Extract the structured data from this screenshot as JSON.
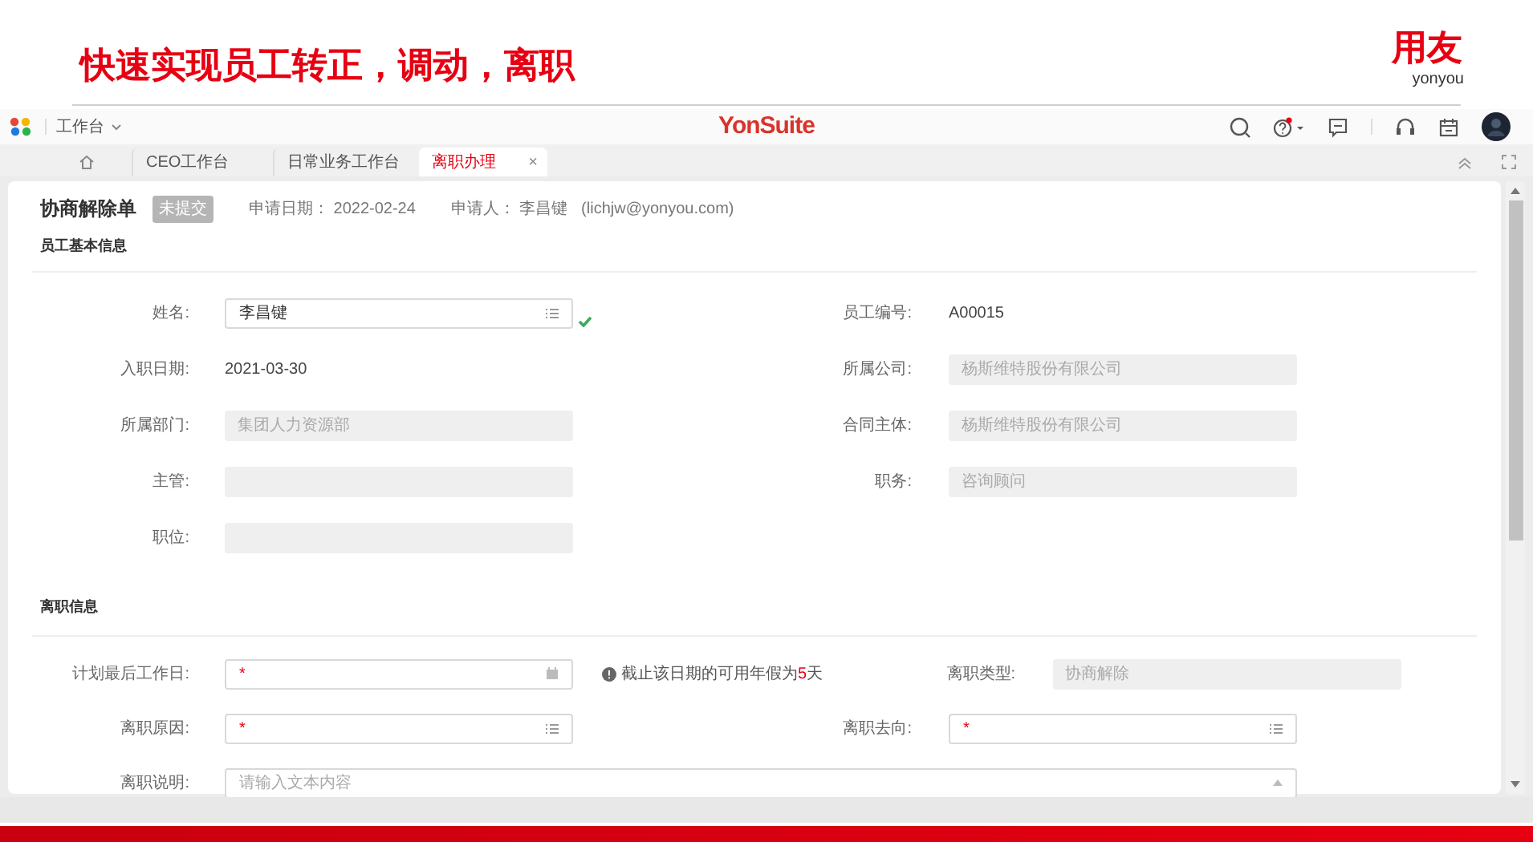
{
  "slide": {
    "title": "快速实现员工转正，调动，离职",
    "logo_text": "用友",
    "logo_subtext": "yonyou"
  },
  "header": {
    "workspace": "工作台",
    "brand": "YonSuite"
  },
  "tabs": [
    {
      "kind": "home",
      "selected": false
    },
    {
      "kind": "text",
      "label": "CEO工作台",
      "selected": false
    },
    {
      "kind": "text",
      "label": "日常业务工作台",
      "selected": false
    },
    {
      "kind": "text",
      "label": "离职办理",
      "selected": true,
      "close": "×"
    }
  ],
  "form": {
    "title": "协商解除单",
    "status": "未提交",
    "date_label": "申请日期：",
    "date": "2022-02-24",
    "applicant_label": "申请人：",
    "applicant": "李昌键",
    "email": "(lichjw@yonyou.com)"
  },
  "sections": [
    {
      "title": "员工基本信息",
      "rows": [
        [
          {
            "label": "姓名:",
            "kind": "select",
            "value": "李昌键",
            "validated": true
          },
          {
            "label": "员工编号:",
            "kind": "static",
            "value": "A00015"
          }
        ],
        [
          {
            "label": "入职日期:",
            "kind": "static",
            "value": "2021-03-30"
          },
          {
            "label": "所属公司:",
            "kind": "readonly",
            "value": "杨斯维特股份有限公司"
          }
        ],
        [
          {
            "label": "所属部门:",
            "kind": "readonly",
            "value": "集团人力资源部"
          },
          {
            "label": "合同主体:",
            "kind": "readonly",
            "value": "杨斯维特股份有限公司"
          }
        ],
        [
          {
            "label": "主管:",
            "kind": "readonly"
          },
          {
            "label": "职务:",
            "kind": "readonly",
            "value": "咨询顾问"
          }
        ],
        [
          {
            "label": "职位:",
            "kind": "readonly"
          }
        ]
      ]
    },
    {
      "title": "离职信息",
      "rows": [
        [
          {
            "label": "计划最后工作日:",
            "kind": "date",
            "required_mark": "*",
            "hint": "截止该日期的可用年假为**5**天"
          },
          {
            "label": "离职类型:",
            "kind": "readonly",
            "value": "协商解除"
          }
        ],
        [
          {
            "label": "离职原因:",
            "kind": "select",
            "required_mark": "*"
          },
          {
            "label": "离职去向:",
            "kind": "select",
            "required_mark": "*"
          }
        ],
        [
          {
            "label": "离职说明:",
            "kind": "textarea",
            "placeholder": "请输入文本内容"
          }
        ]
      ]
    }
  ]
}
